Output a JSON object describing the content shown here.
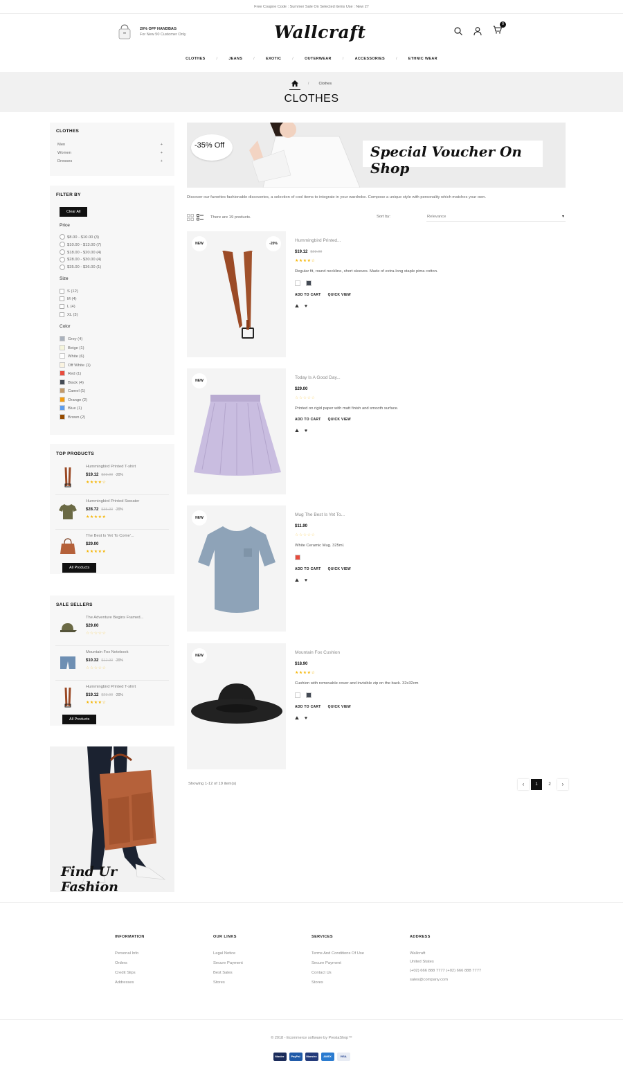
{
  "topbar": {
    "text": "Free Coupne Code : Summer Sale On Selected items Use : New 27"
  },
  "promo": {
    "title": "20% OFF HANDBAG",
    "subtitle": "For New 50 Customer Only"
  },
  "logo": "Wallcraft",
  "cart": {
    "count": "0"
  },
  "nav": [
    "CLOTHES",
    "JEANS",
    "EXOTIC",
    "OUTERWEAR",
    "ACCESSORIES",
    "ETHNIC WEAR"
  ],
  "breadcrumb": {
    "current": "Clothes",
    "title": "CLOTHES"
  },
  "categories": {
    "title": "CLOTHES",
    "items": [
      "Men",
      "Women",
      "Dresses"
    ]
  },
  "filter": {
    "title": "FILTER BY",
    "clear": "Clear All",
    "price_title": "Price",
    "prices": [
      "$8.00 - $10.00 (3)",
      "$10.00 - $13.00 (7)",
      "$18.00 - $20.00 (4)",
      "$28.00 - $30.00 (4)",
      "$35.00 - $36.00 (1)"
    ],
    "size_title": "Size",
    "sizes": [
      "S (12)",
      "M (4)",
      "L (4)",
      "XL (3)"
    ],
    "color_title": "Color",
    "colors": [
      {
        "label": "Grey (4)",
        "hex": "#aab2bd"
      },
      {
        "label": "Beige (1)",
        "hex": "#f5f5dc"
      },
      {
        "label": "White (6)",
        "hex": "#ffffff"
      },
      {
        "label": "Off White (1)",
        "hex": "#faf3e0"
      },
      {
        "label": "Red (1)",
        "hex": "#e84c3d"
      },
      {
        "label": "Black (4)",
        "hex": "#434a54"
      },
      {
        "label": "Camel (1)",
        "hex": "#c19a6b"
      },
      {
        "label": "Orange (2)",
        "hex": "#f39c11"
      },
      {
        "label": "Blue (1)",
        "hex": "#5d9cec"
      },
      {
        "label": "Brown (2)",
        "hex": "#964b00"
      }
    ]
  },
  "top_products": {
    "title": "TOP PRODUCTS",
    "items": [
      {
        "name": "Hummingbird Printed T-shirt",
        "price": "$19.12",
        "old": "$23.90",
        "disc": "-20%"
      },
      {
        "name": "Hummingbird Printed Sweater",
        "price": "$28.72",
        "old": "$35.90",
        "disc": "-20%"
      },
      {
        "name": "The Best Is Yet To Come'...",
        "price": "$29.00",
        "old": "",
        "disc": ""
      }
    ],
    "button": "All Products"
  },
  "sale_sellers": {
    "title": "SALE SELLERS",
    "items": [
      {
        "name": "The Adventure Begins Framed...",
        "price": "$29.00",
        "old": "",
        "disc": ""
      },
      {
        "name": "Mountain Fox Notebook",
        "price": "$10.32",
        "old": "$12.90",
        "disc": "-20%"
      },
      {
        "name": "Hummingbird Printed T-shirt",
        "price": "$19.12",
        "old": "$23.90",
        "disc": "-20%"
      }
    ],
    "button": "All Products"
  },
  "side_banner": {
    "text": "Find Ur Fashion"
  },
  "banner": {
    "discount": "-35% Off",
    "headline": "Special Voucher On Shop"
  },
  "intro": "Discover our favorites fashionable discoveries, a selection of cool items to integrate in your wardrobe. Compose a unique style with personality which matches your own.",
  "toolbar": {
    "count": "There are 19 products.",
    "sort_label": "Sort by:",
    "sort_value": "Relevance"
  },
  "products": [
    {
      "badge": "NEW",
      "discount": "-20%",
      "name": "Hummingbird Printed...",
      "price": "$19.12",
      "old": "$23.90",
      "desc": "Regular fit, round neckline, short sleeves. Made of extra-long staple pima cotton.",
      "swatches": [
        "#ffffff",
        "#434a54"
      ]
    },
    {
      "badge": "NEW",
      "discount": "",
      "name": "Today Is A Good Day...",
      "price": "$29.00",
      "old": "",
      "desc": "Printed on rigid paper with matt finish and smooth surface.",
      "swatches": []
    },
    {
      "badge": "NEW",
      "discount": "",
      "name": "Mug The Best Is Yet To...",
      "price": "$11.90",
      "old": "",
      "desc": "White Ceramic Mug. 325ml.",
      "swatches": [
        "#e84c3d"
      ]
    },
    {
      "badge": "NEW",
      "discount": "",
      "name": "Mountain Fox Cushion",
      "price": "$18.90",
      "old": "",
      "desc": "Cushion with removable cover and invisible zip on the back. 32x32cm",
      "swatches": [
        "#ffffff",
        "#434a54"
      ]
    }
  ],
  "actions": {
    "add": "ADD TO CART",
    "quick": "QUICK VIEW"
  },
  "pagination": {
    "showing": "Showing 1-12 of 19 item(s)",
    "pages": [
      "1",
      "2"
    ]
  },
  "footer": {
    "cols": [
      {
        "title": "INFORMATION",
        "links": [
          "Personal Info",
          "Orders",
          "Credit Slips",
          "Addresses"
        ]
      },
      {
        "title": "OUR LINKS",
        "links": [
          "Legal Notice",
          "Secure Payment",
          "Best Sales",
          "Stores"
        ]
      },
      {
        "title": "SERVICES",
        "links": [
          "Terms And Conditions Of Use",
          "Secure Payment",
          "Contact Us",
          "Stores"
        ]
      },
      {
        "title": "ADDRESS",
        "links": [
          "Wallcraft",
          "United States",
          "(+02) 666 888 7777 (+02) 666 888 7777",
          "sales@company.com"
        ]
      }
    ],
    "copyright": "© 2018 - Ecommerce software by PrestaShop™",
    "payments": [
      "Master",
      "PayPal",
      "Maestro",
      "AMEX",
      "VISA"
    ]
  }
}
